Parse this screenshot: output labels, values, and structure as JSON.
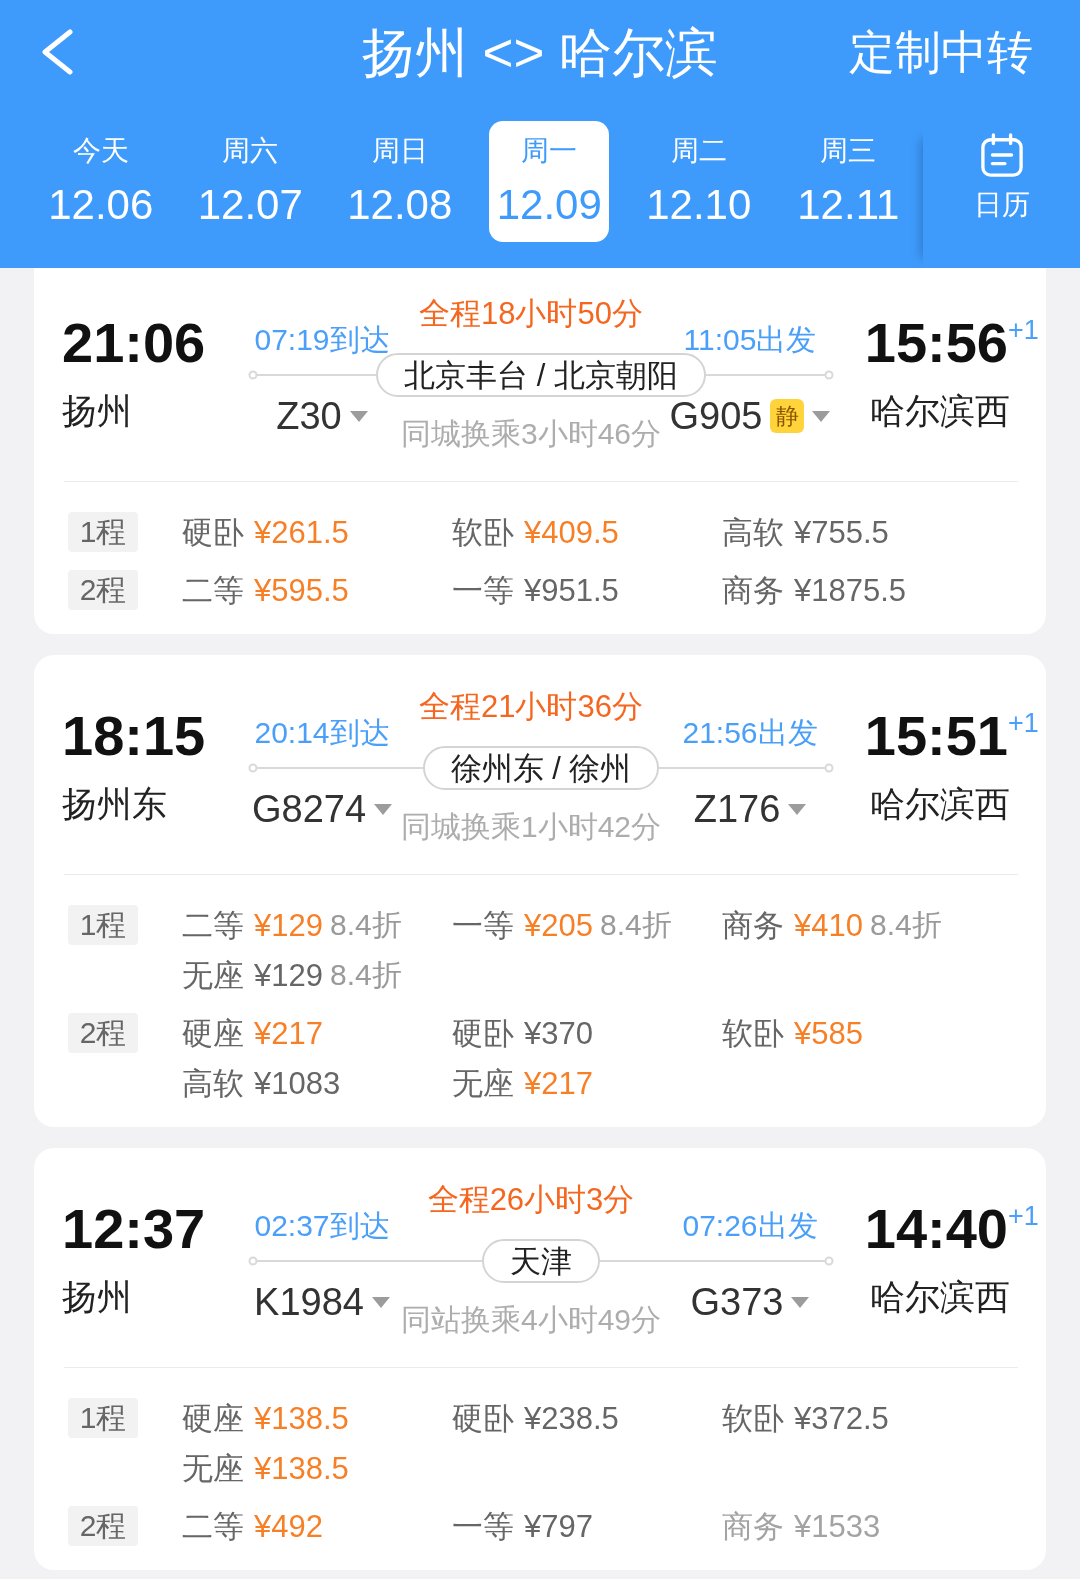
{
  "header": {
    "title": "扬州 <> 哈尔滨",
    "action": "定制中转"
  },
  "dates": [
    {
      "weekday": "今天",
      "date": "12.06",
      "selected": false
    },
    {
      "weekday": "周六",
      "date": "12.07",
      "selected": false
    },
    {
      "weekday": "周日",
      "date": "12.08",
      "selected": false
    },
    {
      "weekday": "周一",
      "date": "12.09",
      "selected": true
    },
    {
      "weekday": "周二",
      "date": "12.10",
      "selected": false
    },
    {
      "weekday": "周三",
      "date": "12.11",
      "selected": false
    }
  ],
  "calendar": {
    "label": "日历"
  },
  "routes": [
    {
      "depart_time": "21:06",
      "depart_station": "扬州",
      "total": "全程18小时50分",
      "leg1": {
        "time": "07:19到达",
        "train": "Z30"
      },
      "transfer": {
        "station": "北京丰台 / 北京朝阳",
        "note": "同城换乘3小时46分"
      },
      "leg2": {
        "time": "11:05出发",
        "train": "G905",
        "badge": "静"
      },
      "arrive_time": "15:56",
      "day_offset": "+1",
      "arrive_station": "哈尔滨西",
      "fares": [
        {
          "leg": "1程",
          "seats": [
            {
              "name": "硬卧",
              "price": "¥261.5",
              "highlighted": true,
              "dimmed": false
            },
            {
              "name": "软卧",
              "price": "¥409.5",
              "highlighted": true,
              "dimmed": false
            },
            {
              "name": "高软",
              "price": "¥755.5",
              "highlighted": false,
              "dimmed": false
            }
          ]
        },
        {
          "leg": "2程",
          "seats": [
            {
              "name": "二等",
              "price": "¥595.5",
              "highlighted": true,
              "dimmed": false
            },
            {
              "name": "一等",
              "price": "¥951.5",
              "highlighted": false,
              "dimmed": false
            },
            {
              "name": "商务",
              "price": "¥1875.5",
              "highlighted": false,
              "dimmed": false
            }
          ]
        }
      ]
    },
    {
      "depart_time": "18:15",
      "depart_station": "扬州东",
      "total": "全程21小时36分",
      "leg1": {
        "time": "20:14到达",
        "train": "G8274"
      },
      "transfer": {
        "station": "徐州东 / 徐州",
        "note": "同城换乘1小时42分"
      },
      "leg2": {
        "time": "21:56出发",
        "train": "Z176"
      },
      "arrive_time": "15:51",
      "day_offset": "+1",
      "arrive_station": "哈尔滨西",
      "fares": [
        {
          "leg": "1程",
          "seats": [
            {
              "name": "二等",
              "price": "¥129",
              "discount": "8.4折",
              "highlighted": true,
              "dimmed": false
            },
            {
              "name": "一等",
              "price": "¥205",
              "discount": "8.4折",
              "highlighted": true,
              "dimmed": false
            },
            {
              "name": "商务",
              "price": "¥410",
              "discount": "8.4折",
              "highlighted": true,
              "dimmed": false
            },
            {
              "name": "无座",
              "price": "¥129",
              "discount": "8.4折",
              "highlighted": false,
              "dimmed": false
            }
          ]
        },
        {
          "leg": "2程",
          "seats": [
            {
              "name": "硬座",
              "price": "¥217",
              "highlighted": true,
              "dimmed": false
            },
            {
              "name": "硬卧",
              "price": "¥370",
              "highlighted": false,
              "dimmed": false
            },
            {
              "name": "软卧",
              "price": "¥585",
              "highlighted": true,
              "dimmed": false
            },
            {
              "name": "高软",
              "price": "¥1083",
              "highlighted": false,
              "dimmed": false
            },
            {
              "name": "无座",
              "price": "¥217",
              "highlighted": true,
              "dimmed": false
            }
          ]
        }
      ]
    },
    {
      "depart_time": "12:37",
      "depart_station": "扬州",
      "total": "全程26小时3分",
      "leg1": {
        "time": "02:37到达",
        "train": "K1984"
      },
      "transfer": {
        "station": "天津",
        "note": "同站换乘4小时49分"
      },
      "leg2": {
        "time": "07:26出发",
        "train": "G373"
      },
      "arrive_time": "14:40",
      "day_offset": "+1",
      "arrive_station": "哈尔滨西",
      "fares": [
        {
          "leg": "1程",
          "seats": [
            {
              "name": "硬座",
              "price": "¥138.5",
              "highlighted": true,
              "dimmed": false
            },
            {
              "name": "硬卧",
              "price": "¥238.5",
              "highlighted": false,
              "dimmed": false
            },
            {
              "name": "软卧",
              "price": "¥372.5",
              "highlighted": false,
              "dimmed": false
            },
            {
              "name": "无座",
              "price": "¥138.5",
              "highlighted": true,
              "dimmed": false
            }
          ]
        },
        {
          "leg": "2程",
          "seats": [
            {
              "name": "二等",
              "price": "¥492",
              "highlighted": true,
              "dimmed": false
            },
            {
              "name": "一等",
              "price": "¥797",
              "highlighted": false,
              "dimmed": false
            },
            {
              "name": "商务",
              "price": "¥1533",
              "highlighted": false,
              "dimmed": true
            }
          ]
        }
      ]
    }
  ]
}
